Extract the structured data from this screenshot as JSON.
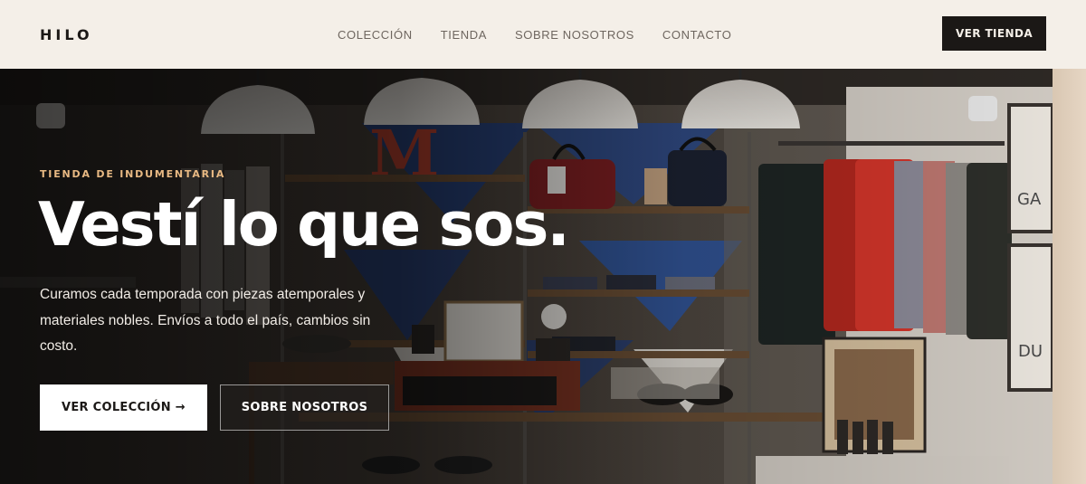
{
  "header": {
    "logo": "HILO",
    "nav": [
      "COLECCIÓN",
      "TIENDA",
      "SOBRE NOSOTROS",
      "CONTACTO"
    ],
    "cta": "VER TIENDA"
  },
  "hero": {
    "eyebrow": "TIENDA DE INDUMENTARIA",
    "headline": "Vestí lo que sos.",
    "lead": "Curamos cada temporada con piezas atemporales y materiales nobles. Envíos a todo el país, cambios sin costo.",
    "primary_button": "VER COLECCIÓN →",
    "secondary_button": "SOBRE NOSOTROS",
    "background_sign_letters": [
      "M",
      "GA",
      "DU"
    ]
  },
  "colors": {
    "header_bg": "#f4efe8",
    "dark": "#1b1816",
    "eyebrow_accent": "#e8b983",
    "nav_text": "#6e665f"
  }
}
